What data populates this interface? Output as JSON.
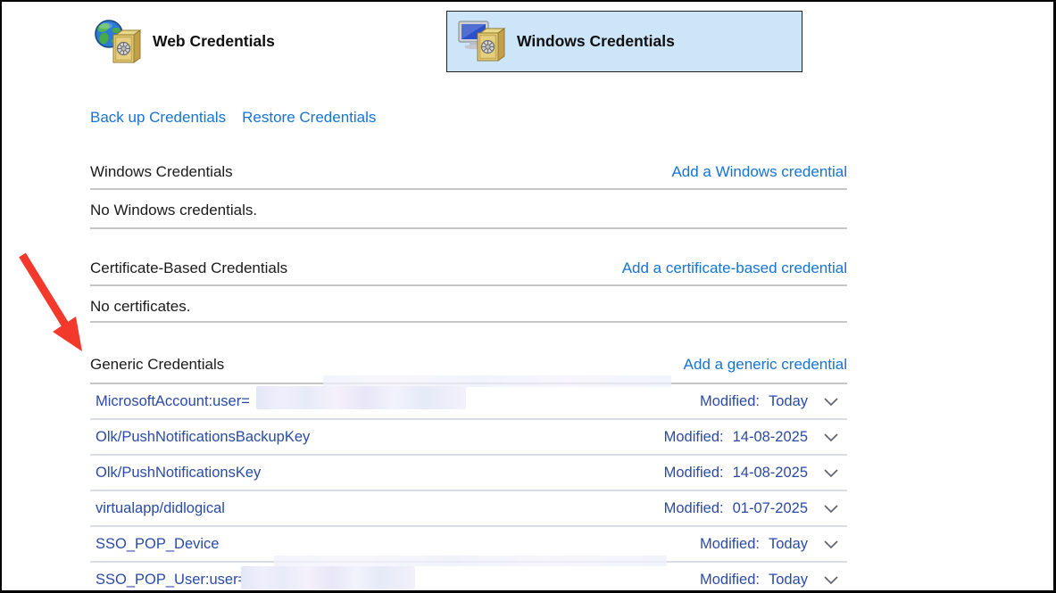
{
  "tabs": {
    "web": {
      "label": "Web Credentials"
    },
    "windows": {
      "label": "Windows Credentials"
    }
  },
  "actions": {
    "backup": "Back up Credentials",
    "restore": "Restore Credentials"
  },
  "sections": {
    "windows": {
      "title": "Windows Credentials",
      "add_link": "Add a Windows credential",
      "empty": "No Windows credentials."
    },
    "certificate": {
      "title": "Certificate-Based Credentials",
      "add_link": "Add a certificate-based credential",
      "empty": "No certificates."
    },
    "generic": {
      "title": "Generic Credentials",
      "add_link": "Add a generic credential"
    }
  },
  "labels": {
    "modified": "Modified:"
  },
  "credentials": [
    {
      "name": "MicrosoftAccount:user=",
      "modified": "Today",
      "redacted": true
    },
    {
      "name": "Olk/PushNotificationsBackupKey",
      "modified": "14-08-2025",
      "redacted": false
    },
    {
      "name": "Olk/PushNotificationsKey",
      "modified": "14-08-2025",
      "redacted": false
    },
    {
      "name": "virtualapp/didlogical",
      "modified": "01-07-2025",
      "redacted": false
    },
    {
      "name": "SSO_POP_Device",
      "modified": "Today",
      "redacted": false
    },
    {
      "name": "SSO_POP_User:user=",
      "modified": "Today",
      "redacted": true
    }
  ],
  "colors": {
    "link_blue": "#1474d4",
    "credential_blue": "#2a4aa5",
    "selected_tab_bg": "#cde5f8",
    "arrow_red": "#f2392c"
  }
}
